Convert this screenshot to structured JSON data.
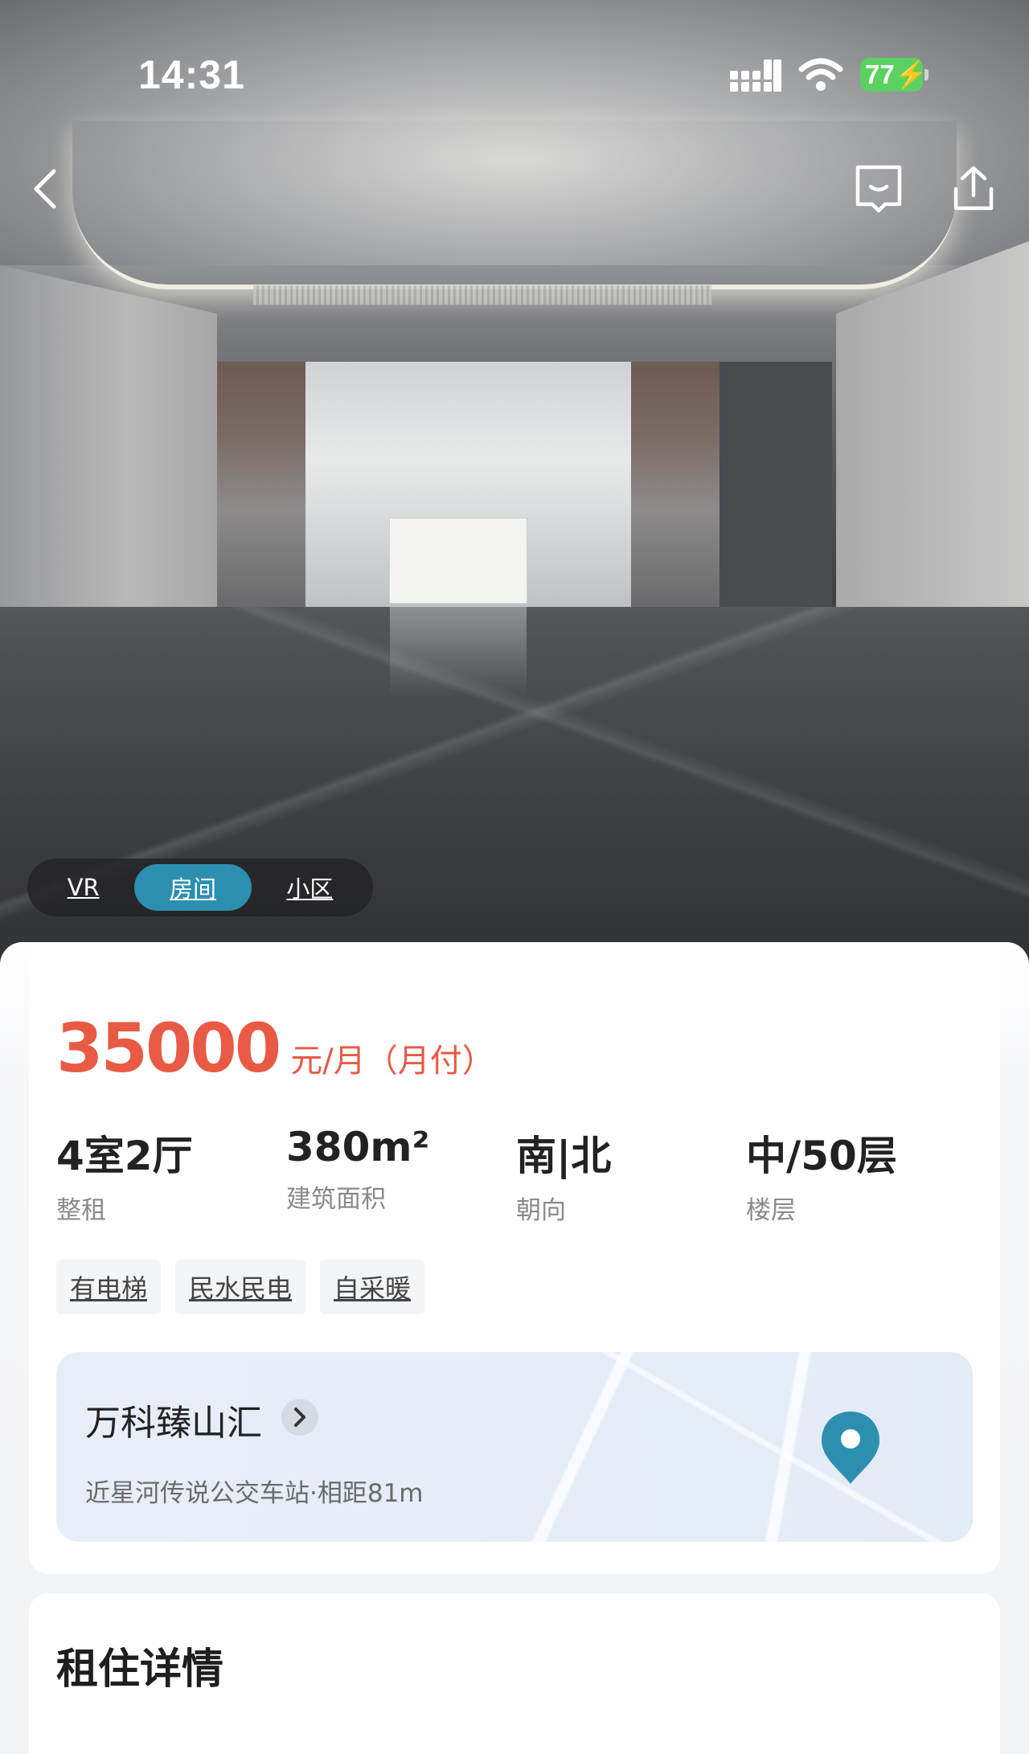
{
  "status_bar": {
    "time": "14:31",
    "battery": "77"
  },
  "hero": {
    "tabs": [
      {
        "label": "VR",
        "active": false
      },
      {
        "label": "房间",
        "active": true
      },
      {
        "label": "小区",
        "active": false
      }
    ],
    "icons": {
      "back": "back-arrow-icon",
      "comment": "comment-icon",
      "share": "share-icon"
    }
  },
  "listing": {
    "price": "35000",
    "price_unit": "元/月（月付）",
    "price_color": "#e85a43",
    "specs": [
      {
        "value": "4室2厅",
        "label": "整租"
      },
      {
        "value": "380m²",
        "label": "建筑面积"
      },
      {
        "value": "南|北",
        "label": "朝向"
      },
      {
        "value": "中/50层",
        "label": "楼层"
      }
    ],
    "tags": [
      "有电梯",
      "民水民电",
      "自采暖"
    ]
  },
  "community": {
    "name": "万科臻山汇",
    "subtitle": "近星河传说公交车站·相距81m",
    "pin_color": "#2d8fb0"
  },
  "section": {
    "title": "租住详情"
  }
}
